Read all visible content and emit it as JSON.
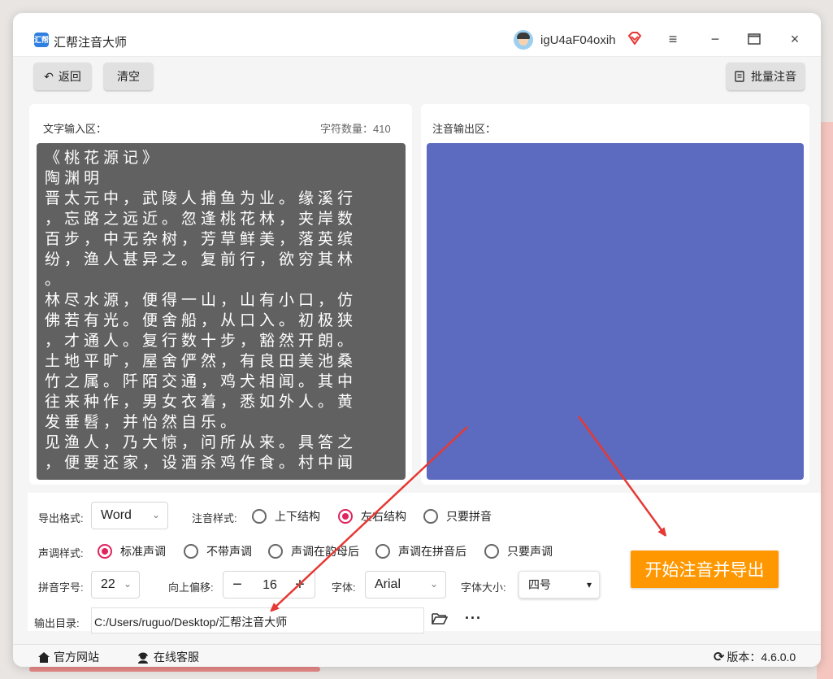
{
  "window": {
    "title": "汇帮注音大师",
    "logo_text": "汇帮",
    "username": "igU4aF04oxih",
    "icons": {
      "vip": "vip-diamond-icon",
      "menu": "menu-icon",
      "minimize": "minimize-icon",
      "maximize": "maximize-icon",
      "close": "close-icon"
    }
  },
  "toolbar": {
    "back_label": "返回",
    "clear_label": "清空",
    "batch_label": "批量注音"
  },
  "input_panel": {
    "label": "文字输入区：",
    "char_count_label": "字符数量：",
    "char_count": "410",
    "text": "《桃花源记》\n陶渊明\n晋太元中，武陵人捕鱼为业。缘溪行\n，忘路之远近。忽逢桃花林，夹岸数\n百步，中无杂树，芳草鲜美，落英缤\n纷，渔人甚异之。复前行，欲穷其林\n。\n林尽水源，便得一山，山有小口，仿\n佛若有光。便舍船，从口入。初极狭\n，才通人。复行数十步，豁然开朗。\n土地平旷，屋舍俨然，有良田美池桑\n竹之属。阡陌交通，鸡犬相闻。其中\n往来种作，男女衣着，悉如外人。黄\n发垂髫，并怡然自乐。\n见渔人，乃大惊，问所从来。具答之\n，便要还家，设酒杀鸡作食。村中闻"
  },
  "output_panel": {
    "label": "注音输出区："
  },
  "options": {
    "export_format_label": "导出格式:",
    "export_format_value": "Word",
    "style_label": "注音样式:",
    "style_options": [
      "上下结构",
      "左右结构",
      "只要拼音"
    ],
    "style_selected": 1,
    "tone_label": "声调样式:",
    "tone_options": [
      "标准声调",
      "不带声调",
      "声调在韵母后",
      "声调在拼音后",
      "只要声调"
    ],
    "tone_selected": 0,
    "pinyin_size_label": "拼音字号:",
    "pinyin_size_value": "22",
    "offset_label": "向上偏移:",
    "offset_value": "16",
    "font_label": "字体:",
    "font_value": "Arial",
    "font_size_label": "字体大小:",
    "font_size_value": "四号",
    "output_dir_label": "输出目录:",
    "output_dir_value": "C:/Users/ruguo/Desktop/汇帮注音大师",
    "start_button_label": "开始注音并导出"
  },
  "footer": {
    "website_label": "官方网站",
    "support_label": "在线客服",
    "version_label": "版本：",
    "version_value": "4.6.0.0"
  },
  "colors": {
    "accent_pink": "#e0245e",
    "output_blue": "#5c6bc0",
    "start_orange": "#ff9800",
    "input_gray": "#616161",
    "annotation_red": "#e53935"
  }
}
